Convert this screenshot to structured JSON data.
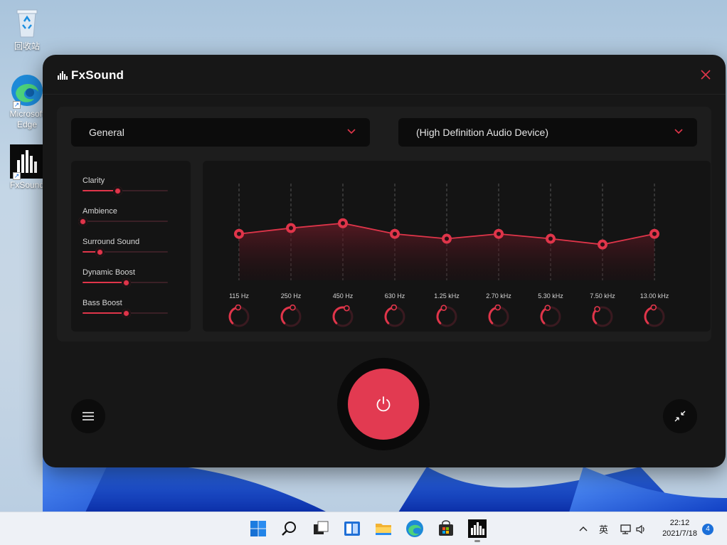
{
  "desktop": {
    "icons": [
      {
        "label": "回收站",
        "icon": "recycle-bin-icon"
      },
      {
        "label": "Microsoft Edge",
        "icon": "edge-icon"
      },
      {
        "label": "FxSound",
        "icon": "fxsound-icon"
      }
    ]
  },
  "app": {
    "brand": "FxSound",
    "preset": "General",
    "device": "(High Definition Audio Device)",
    "accent": "#e0354a",
    "effects": [
      {
        "label": "Clarity",
        "value": 0.41
      },
      {
        "label": "Ambience",
        "value": 0.0
      },
      {
        "label": "Surround Sound",
        "value": 0.2
      },
      {
        "label": "Dynamic Boost",
        "value": 0.51
      },
      {
        "label": "Bass Boost",
        "value": 0.51
      }
    ],
    "eq_bands": [
      {
        "freq": "115 Hz",
        "level": 0.48
      },
      {
        "freq": "250 Hz",
        "level": 0.54
      },
      {
        "freq": "450 Hz",
        "level": 0.59
      },
      {
        "freq": "630 Hz",
        "level": 0.48
      },
      {
        "freq": "1.25 kHz",
        "level": 0.43
      },
      {
        "freq": "2.70 kHz",
        "level": 0.48
      },
      {
        "freq": "5.30 kHz",
        "level": 0.43
      },
      {
        "freq": "7.50 kHz",
        "level": 0.37
      },
      {
        "freq": "13.00 kHz",
        "level": 0.48
      }
    ],
    "buttons": {
      "power": "power-icon",
      "menu": "hamburger-menu-icon",
      "minimize": "collapse-arrows-icon",
      "close": "close-icon"
    }
  },
  "taskbar": {
    "apps": [
      "windows-start-icon",
      "search-icon",
      "task-view-icon",
      "widgets-icon",
      "file-explorer-icon",
      "edge-icon",
      "store-icon",
      "fxsound-icon"
    ],
    "ime": "英",
    "time": "22:12",
    "date": "2021/7/18",
    "notifications": "4"
  }
}
